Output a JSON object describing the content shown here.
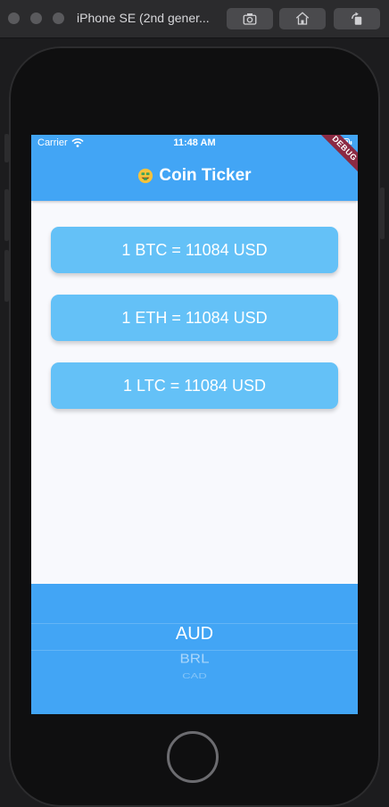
{
  "window": {
    "title": "iPhone SE (2nd gener..."
  },
  "status_bar": {
    "carrier": "Carrier",
    "time": "11:48 AM"
  },
  "app_bar": {
    "emoji": "money-mouth-face",
    "title": "Coin Ticker"
  },
  "debug_banner": {
    "label": "DEBUG"
  },
  "rates": [
    {
      "label": "1 BTC = 11084 USD"
    },
    {
      "label": "1 ETH = 11084 USD"
    },
    {
      "label": "1 LTC = 11084 USD"
    }
  ],
  "picker": {
    "items": [
      "AUD",
      "BRL",
      "CAD"
    ],
    "selected": "AUD"
  },
  "colors": {
    "accent": "#42a5f5",
    "card": "#64c1f7",
    "debug": "#8b2a43"
  }
}
